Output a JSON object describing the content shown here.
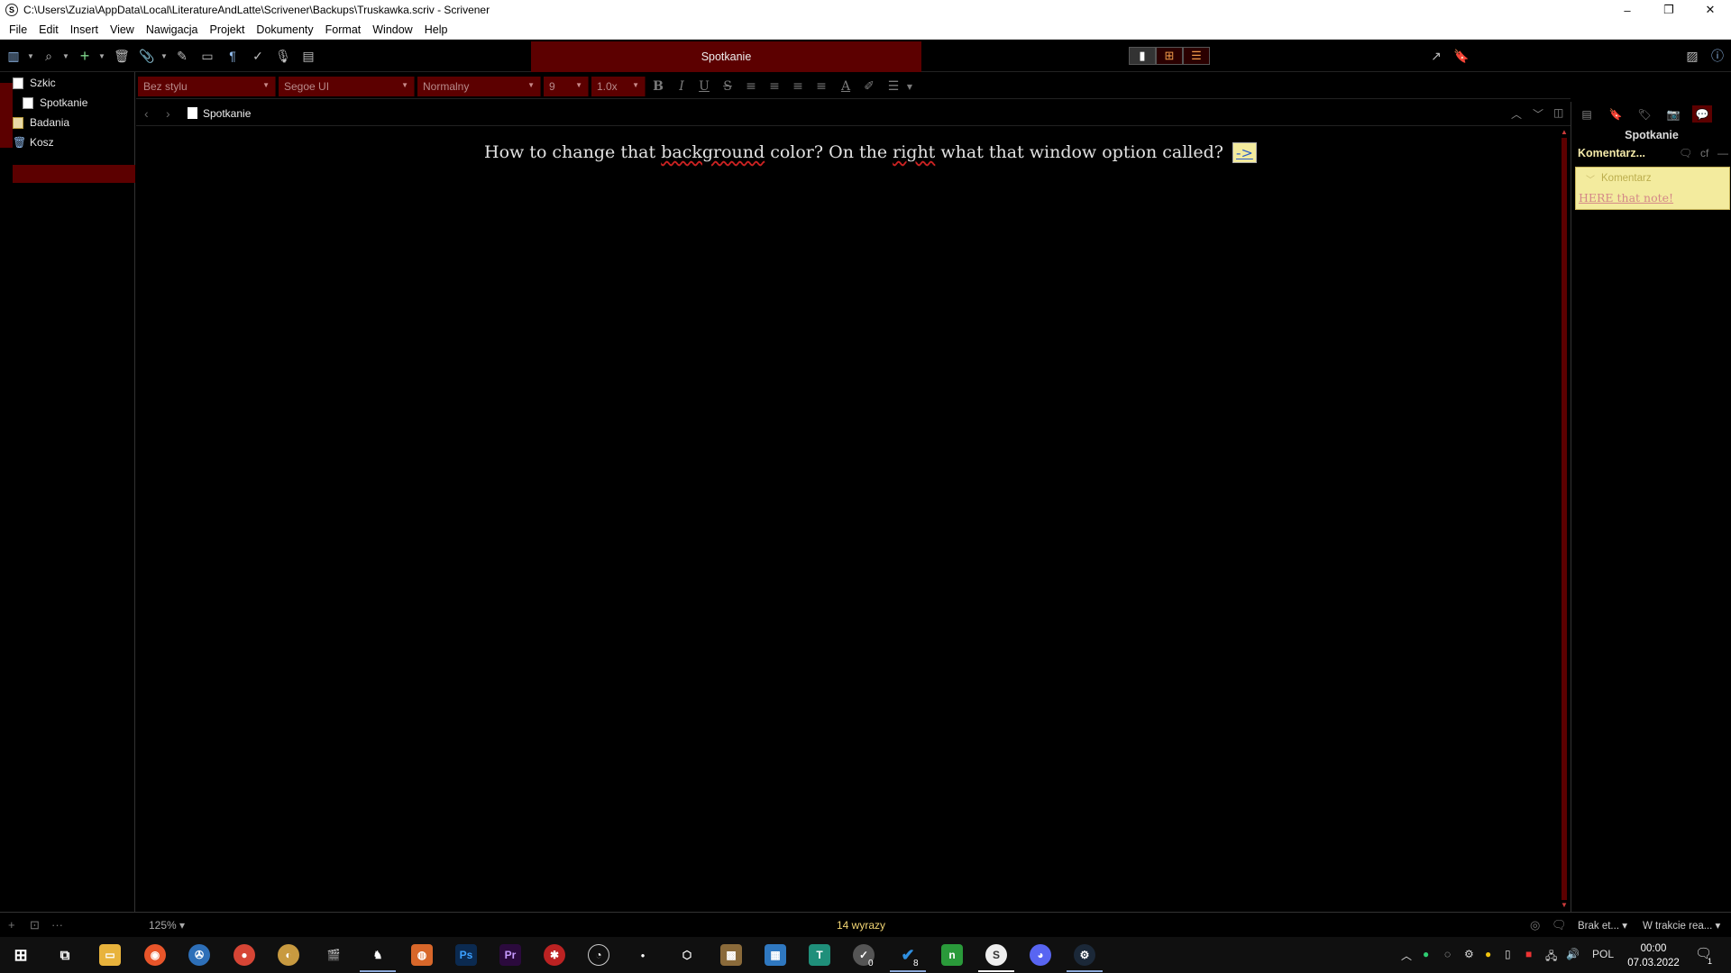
{
  "window": {
    "title": "C:\\Users\\Zuzia\\AppData\\Local\\LiteratureAndLatte\\Scrivener\\Backups\\Truskawka.scriv - Scrivener",
    "minimize": "–",
    "restore": "❐",
    "close": "✕"
  },
  "menu": [
    "File",
    "Edit",
    "Insert",
    "View",
    "Nawigacja",
    "Projekt",
    "Dokumenty",
    "Format",
    "Window",
    "Help"
  ],
  "toolbar": {
    "document_title": "Spotkanie"
  },
  "binder": {
    "items": [
      {
        "label": "Szkic",
        "icon": "draft-icon"
      },
      {
        "label": "Spotkanie",
        "icon": "document-icon"
      },
      {
        "label": "Badania",
        "icon": "research-folder-icon"
      },
      {
        "label": "Kosz",
        "icon": "trash-icon"
      }
    ]
  },
  "formatbar": {
    "style": "Bez stylu",
    "font": "Segoe UI",
    "typeface": "Normalny",
    "size": "9",
    "line_spacing": "1.0x"
  },
  "editor": {
    "header_title": "Spotkanie",
    "text_parts": [
      "How to change that ",
      "background",
      " color? On the ",
      "right",
      " what that window option called?"
    ],
    "anchor": "->"
  },
  "inspector": {
    "title": "Spotkanie",
    "section": "Komentarz...",
    "comment_header": "Komentarz",
    "comment_body": "HERE that note!"
  },
  "footer": {
    "zoom": "125%",
    "word_count": "14 wyrazy",
    "label_dropdown": "Brak et...",
    "status_dropdown": "W trakcie rea..."
  },
  "taskbar": {
    "language": "POL",
    "time": "00:00",
    "date": "07.03.2022",
    "badge_a": "0",
    "badge_b": "8",
    "notifications": "1"
  },
  "colors": {
    "accent_red": "#5c0000",
    "comment_yellow": "#f3eb9e",
    "word_count": "#f2d574"
  }
}
